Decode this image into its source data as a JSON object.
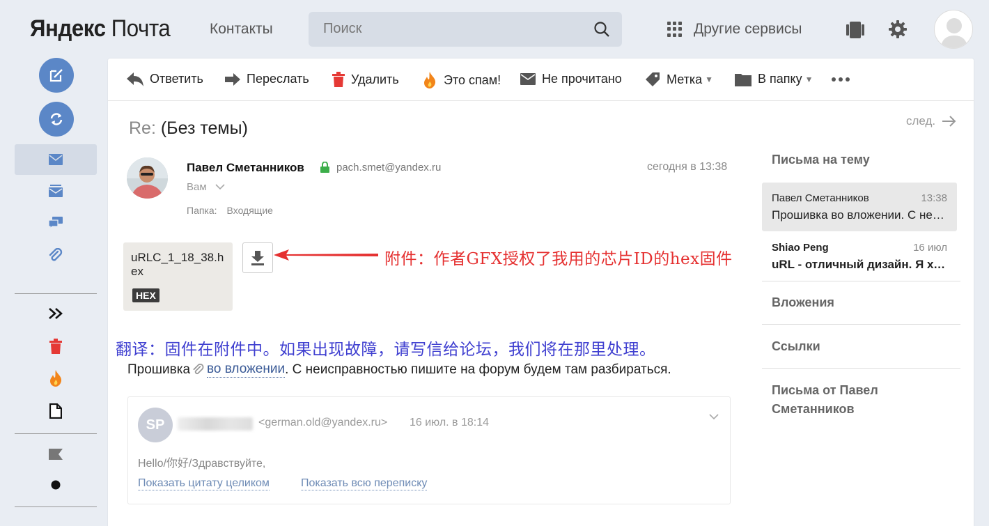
{
  "header": {
    "logo_part1": "Яндекс",
    "logo_part2": "Почта",
    "contacts": "Контакты",
    "search_placeholder": "Поиск",
    "services": "Другие сервисы"
  },
  "toolbar": {
    "reply": "Ответить",
    "forward": "Переслать",
    "delete": "Удалить",
    "spam": "Это спам!",
    "unread": "Не прочитано",
    "label": "Метка",
    "folder": "В папку"
  },
  "message": {
    "subject_prefix": "Re:",
    "subject": "(Без темы)",
    "next": "след.",
    "sender_name": "Павел Сметанников",
    "sender_email": "pach.smet@yandex.ru",
    "time": "сегодня в 13:38",
    "recipient": "Вам",
    "folder_label": "Папка:",
    "folder_value": "Входящие",
    "attachment_name": "uRLC_1_18_38.hex",
    "attachment_type": "HEX",
    "annotation_attach": "附件：作者GFX授权了我用的芯片ID的hex固件",
    "annotation_translation": "翻译：固件在附件中。如果出现故障，请写信给论坛，我们将在那里处理。",
    "body_before": "Прошивка",
    "body_link": "во вложении",
    "body_after": ". С неисправностью пишите на форум будем там разбираться."
  },
  "quote": {
    "initials": "SP",
    "email": "<german.old@yandex.ru>",
    "date": "16 июл. в 18:14",
    "greeting": "Hello/你好/Здравствуйте,",
    "show_quote": "Показать цитату целиком",
    "show_thread": "Показать всю переписку"
  },
  "sidebar": {
    "thread_heading": "Письма на тему",
    "threads": [
      {
        "name": "Павел Сметанников",
        "time": "13:38",
        "snippet": "Прошивка во вложении. С неисправностью"
      },
      {
        "name": "Shiao Peng",
        "time": "16 июл",
        "snippet": "uRL - отличный дизайн. Я хочу"
      }
    ],
    "attachments": "Вложения",
    "links": "Ссылки",
    "from_sender": "Письма от Павел Сметанников"
  },
  "colors": {
    "accent": "#5b87c7",
    "annotation_red": "#e53030",
    "annotation_blue": "#3f3fd0",
    "link": "#3a5a96"
  }
}
